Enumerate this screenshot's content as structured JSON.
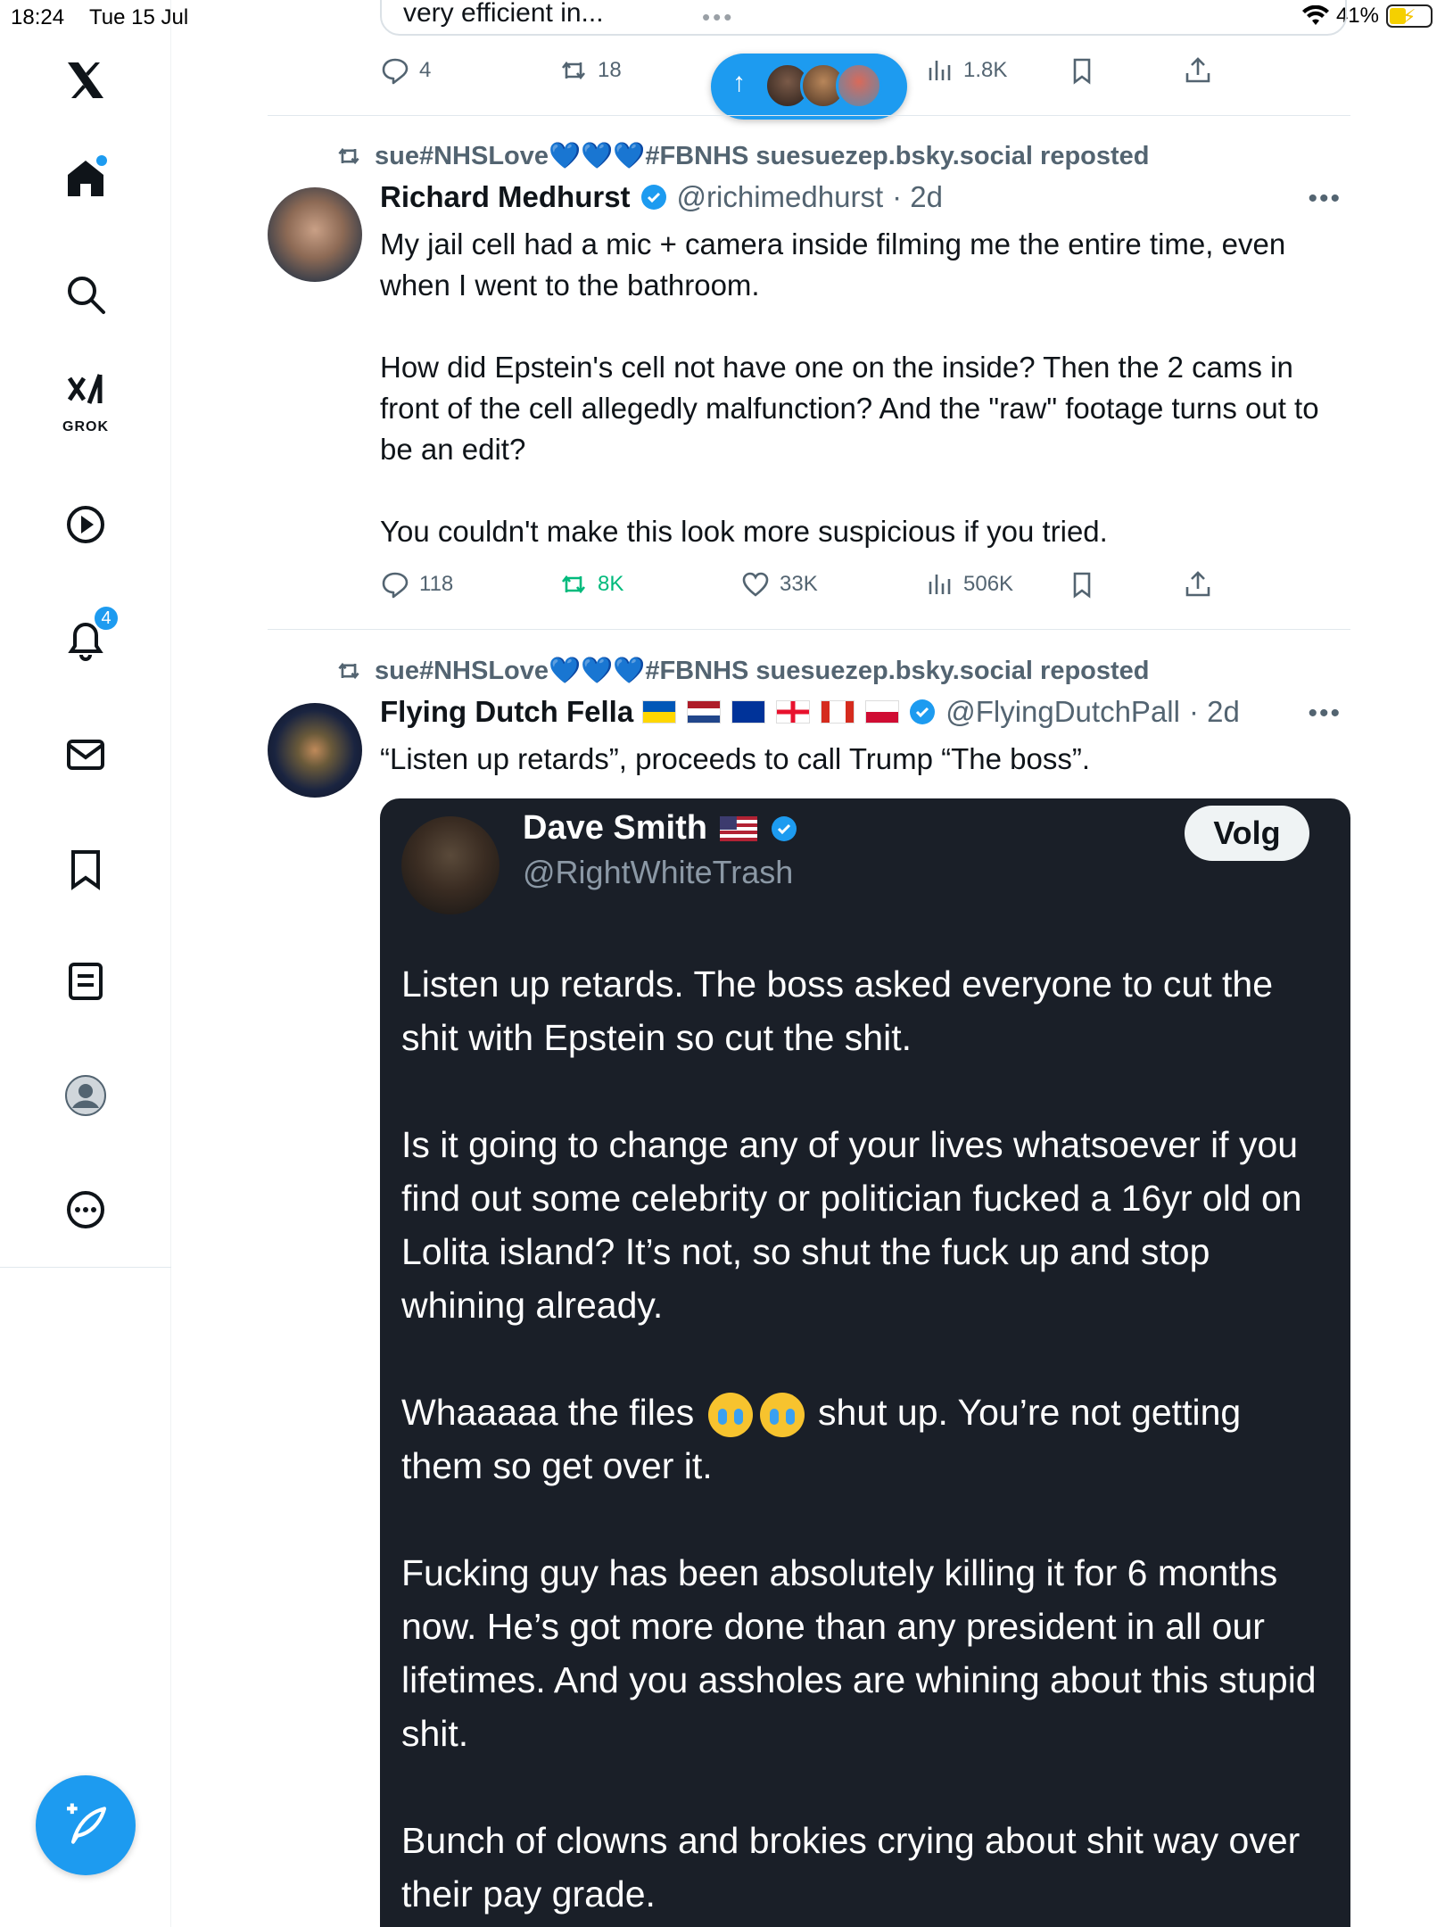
{
  "status_bar": {
    "time": "18:24",
    "date": "Tue 15 Jul",
    "battery": "41%"
  },
  "sidebar": {
    "grok_label": "GROK",
    "notifications_badge": "4"
  },
  "previous_post": {
    "text": "very efficient in...",
    "actions": {
      "replies": "4",
      "reposts": "18",
      "views": "1.8K"
    }
  },
  "posts": [
    {
      "repost_by": "sue#NHSLove💙💙💙#FBNHS suesuezep.bsky.social reposted",
      "name": "Richard Medhurst",
      "handle": "@richimedhurst",
      "time": "· 2d",
      "text": "My jail cell had a mic + camera inside filming me the entire time, even when I went to the bathroom.\n\nHow did Epstein's cell not have one on the inside? Then the 2 cams in front of the cell allegedly malfunction? And the \"raw\" footage turns out to be an edit?\n\nYou couldn't make this look more suspicious if you tried.",
      "actions": {
        "replies": "118",
        "reposts": "8K",
        "likes": "33K",
        "views": "506K"
      }
    },
    {
      "repost_by": "sue#NHSLove💙💙💙#FBNHS suesuezep.bsky.social reposted",
      "name": "Flying Dutch Fella",
      "handle": "@FlyingDutchPall",
      "time": "· 2d",
      "text": "“Listen up retards”, proceeds to call Trump “The boss”.",
      "quote": {
        "name": "Dave Smith",
        "handle": "@RightWhiteTrash",
        "follow_label": "Volg",
        "p1": "Listen up retards. The boss asked everyone to cut the shit with Epstein so cut the shit.",
        "p2": "Is it going to change any of your lives whatsoever if you find out some celebrity or politician fucked a 16yr old on Lolita island? It’s not, so shut the fuck up and stop whining already.",
        "p3a": "Whaaaaa the files",
        "p3b": "shut up. You’re not getting them so get over it.",
        "p4": "Fucking guy has been absolutely killing it for 6 months now. He’s got more done than any president in all our lifetimes. And you assholes are whining about this stupid shit.",
        "p5": "Bunch of clowns and brokies crying about shit way over their pay grade."
      }
    }
  ],
  "colors": {
    "accent": "#1d9bf0",
    "repost_green": "#00ba7c",
    "quote_bg": "#1a1f28"
  }
}
